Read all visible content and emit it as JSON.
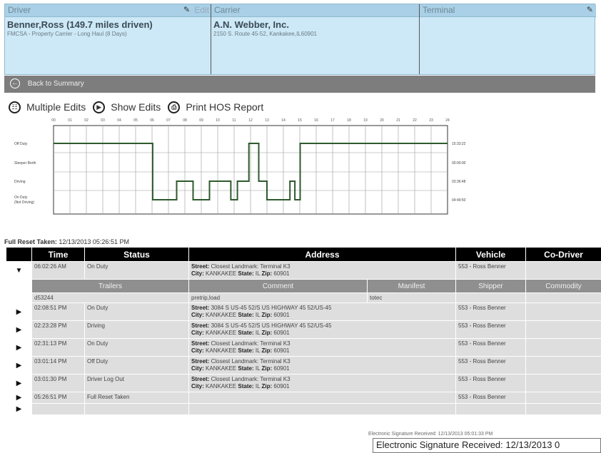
{
  "header": {
    "driver_caption": "Driver",
    "edit_label": "Edit",
    "carrier_caption": "Carrier",
    "terminal_caption": "Terminal",
    "driver_name": "Benner,Ross (149.7 miles driven)",
    "driver_rule": "FMCSA - Property Carrier - Long Haul (8 Days)",
    "carrier_name": "A.N. Webber, Inc.",
    "carrier_address": "2150 S. Route 45-52, Kankakee,IL60901"
  },
  "back_bar": {
    "label": "Back to Summary"
  },
  "toolbar": {
    "multiple_edits": "Multiple Edits",
    "show_edits": "Show Edits",
    "print_report": "Print HOS Report"
  },
  "graph": {
    "hours": [
      "00",
      "01",
      "02",
      "03",
      "04",
      "05",
      "06",
      "07",
      "08",
      "09",
      "10",
      "11",
      "12",
      "13",
      "14",
      "15",
      "16",
      "17",
      "18",
      "19",
      "20",
      "21",
      "22",
      "23",
      "24"
    ],
    "rows": [
      "Off Duty",
      "Sleeper Berth",
      "Driving",
      "On Duty"
    ],
    "row_sub": "(Not Driving)",
    "totals": [
      "15:33:22",
      "00:00:00",
      "03:36:48",
      "04:49:50"
    ],
    "line_color": "#2e5a2e"
  },
  "reset": {
    "label": "Full Reset Taken:",
    "value": "12/13/2013 05:26:51 PM"
  },
  "table": {
    "headers": [
      "Time",
      "Status",
      "Address",
      "Vehicle",
      "Co-Driver"
    ],
    "sub_headers": [
      "Trailers",
      "Comment",
      "Manifest",
      "Shipper",
      "Commodity"
    ],
    "street_label": "Street:",
    "city_label": "City:",
    "state_label": "State:",
    "zip_label": "Zip:",
    "rows": [
      {
        "time": "06:02:26 AM",
        "status": "On Duty",
        "street": "Closest Landmark: Terminal K3",
        "city": "KANKAKEE",
        "state": "IL",
        "zip": "60901",
        "vehicle": "553 - Ross Benner",
        "expanded": "▼"
      },
      {
        "time": "02:08:51 PM",
        "status": "On Duty",
        "street": "3084 S US-45 52/S US HIGHWAY 45 52/US-45",
        "city": "KANKAKEE",
        "state": "IL",
        "zip": "60901",
        "vehicle": "553 - Ross Benner",
        "expanded": "▶"
      },
      {
        "time": "02:23:28 PM",
        "status": "Driving",
        "street": "3084 S US-45 52/S US HIGHWAY 45 52/US-45",
        "city": "KANKAKEE",
        "state": "IL",
        "zip": "60901",
        "vehicle": "553 - Ross Benner",
        "expanded": "▶"
      },
      {
        "time": "02:31:13 PM",
        "status": "On Duty",
        "street": "Closest Landmark: Terminal K3",
        "city": "KANKAKEE",
        "state": "IL",
        "zip": "60901",
        "vehicle": "553 - Ross Benner",
        "expanded": "▶"
      },
      {
        "time": "03:01:14 PM",
        "status": "Off Duty",
        "street": "Closest Landmark: Terminal K3",
        "city": "KANKAKEE",
        "state": "IL",
        "zip": "60901",
        "vehicle": "553 - Ross Benner",
        "expanded": "▶"
      },
      {
        "time": "03:01:30 PM",
        "status": "Driver Log Out",
        "street": "Closest Landmark: Terminal K3",
        "city": "KANKAKEE",
        "state": "IL",
        "zip": "60901",
        "vehicle": "553 - Ross Benner",
        "expanded": "▶"
      },
      {
        "time": "05:26:51 PM",
        "status": "Full Reset Taken",
        "vehicle": "553 - Ross Benner",
        "expanded": "▶"
      }
    ],
    "detail": {
      "trailers": "d53244",
      "comment": "pretrip,load",
      "manifest": "totec"
    },
    "last_expander": "▶"
  },
  "signature": {
    "small": "Electronic Signature Received: 12/13/2013 05:01:33 PM",
    "large": "Electronic Signature Received: 12/13/2013 0"
  }
}
